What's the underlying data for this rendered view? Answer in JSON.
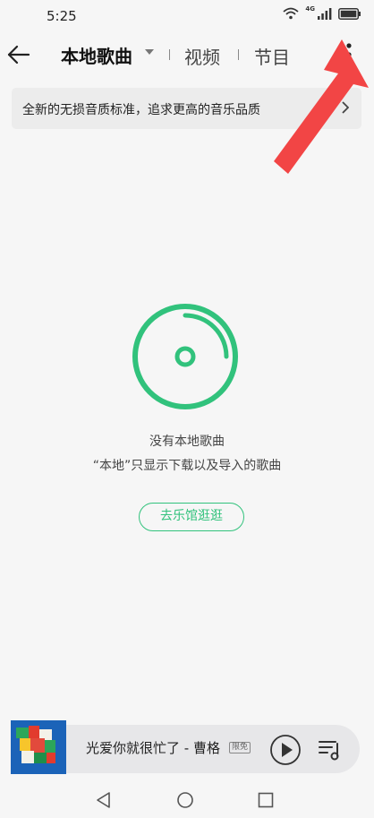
{
  "status_bar": {
    "time": "5:25",
    "network_label": "4G",
    "icons": [
      "wifi-icon",
      "cellular-signal-icon",
      "battery-icon"
    ]
  },
  "header": {
    "tabs": [
      {
        "label": "本地歌曲",
        "active": true
      },
      {
        "label": "视频",
        "active": false
      },
      {
        "label": "节目",
        "active": false
      }
    ],
    "icons": [
      "back-arrow-icon",
      "caret-down-icon",
      "more-vertical-icon"
    ]
  },
  "banner": {
    "text": "全新的无损音质标准，追求更高的音乐品质",
    "icon": "chevron-right-icon"
  },
  "empty_state": {
    "icon": "disc-icon",
    "title": "没有本地歌曲",
    "subtitle": "“本地”只显示下载以及导入的歌曲",
    "button_label": "去乐馆逛逛"
  },
  "player": {
    "song": "光爱你就很忙了 - 曹格",
    "badge": "限免",
    "icons": [
      "play-icon",
      "playlist-icon"
    ]
  },
  "colors": {
    "accent": "#31c27c",
    "annotation_arrow": "#f24545",
    "background": "#f6f6f6"
  }
}
